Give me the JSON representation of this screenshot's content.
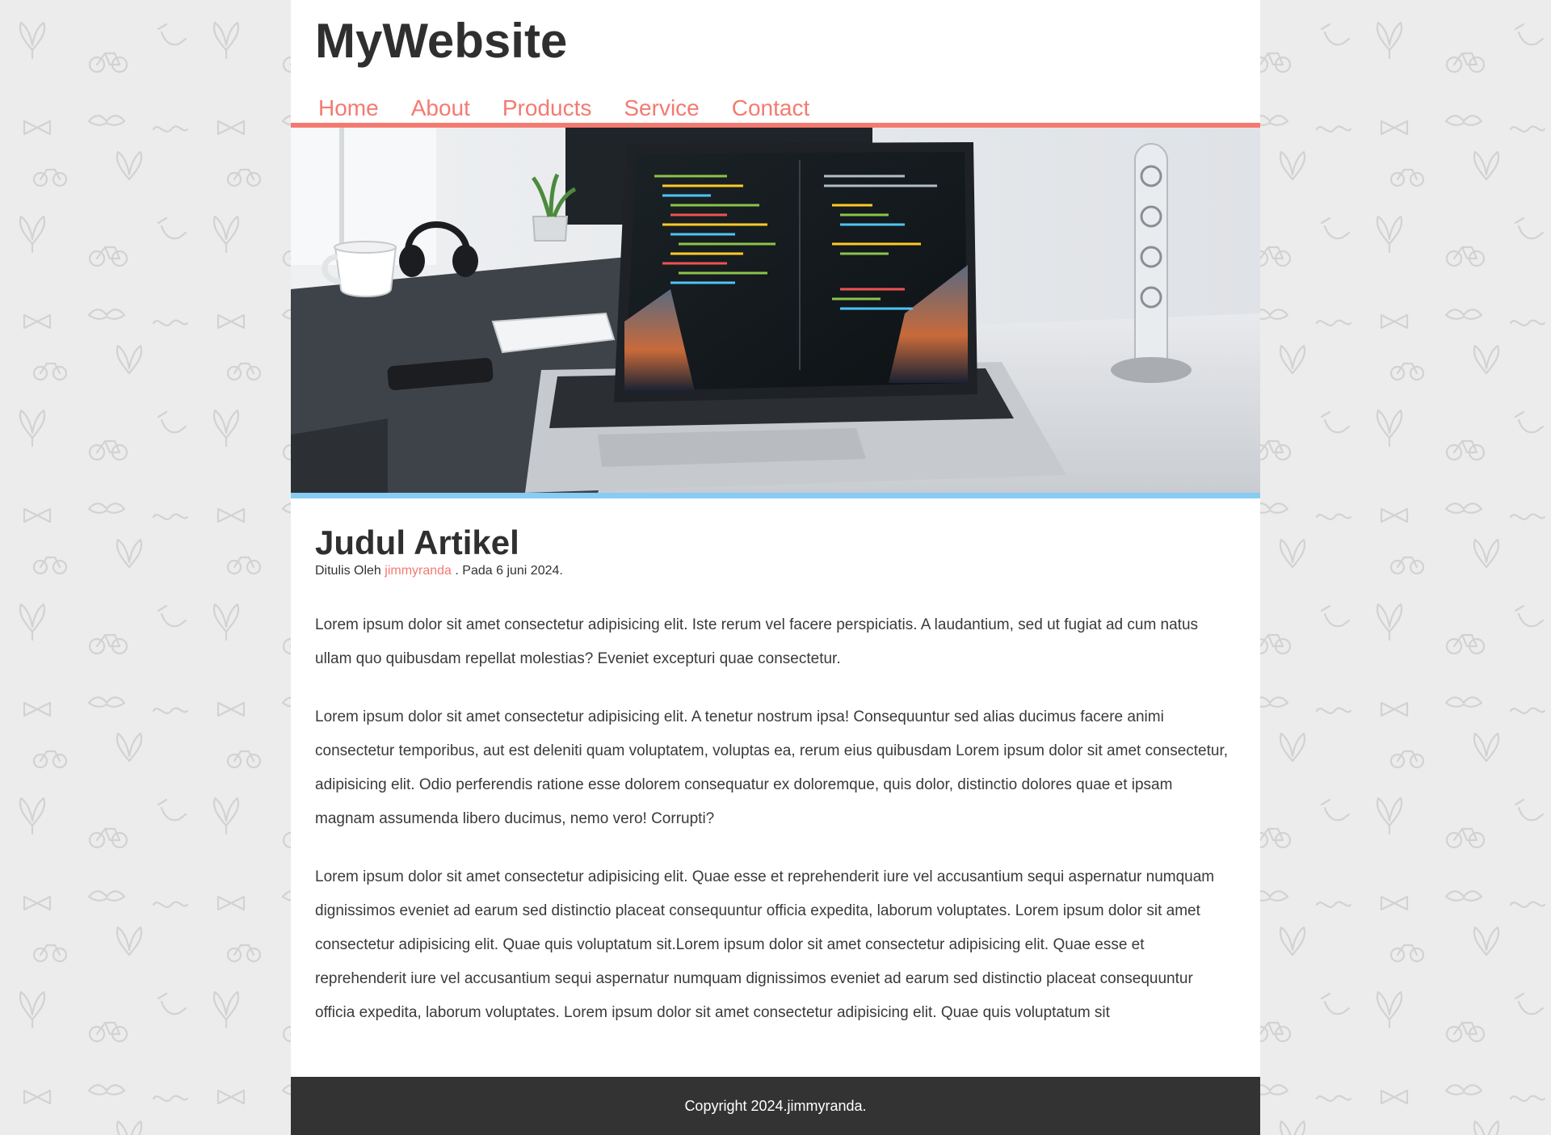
{
  "site": {
    "title": "MyWebsite"
  },
  "nav": {
    "items": [
      {
        "label": "Home"
      },
      {
        "label": "About"
      },
      {
        "label": "Products"
      },
      {
        "label": "Service"
      },
      {
        "label": "Contact"
      }
    ]
  },
  "hero": {
    "icon": "laptop-photo"
  },
  "article": {
    "title": "Judul Artikel",
    "meta_prefix": "Ditulis Oleh",
    "author": "jimmyranda",
    "meta_suffix": ". Pada 6 juni 2024.",
    "paragraphs": [
      "Lorem ipsum dolor sit amet consectetur adipisicing elit. Iste rerum vel facere perspiciatis. A laudantium, sed ut fugiat ad cum natus ullam quo quibusdam repellat molestias? Eveniet excepturi quae consectetur.",
      "Lorem ipsum dolor sit amet consectetur adipisicing elit. A tenetur nostrum ipsa! Consequuntur sed alias ducimus facere animi consectetur temporibus, aut est deleniti quam voluptatem, voluptas ea, rerum eius quibusdam Lorem ipsum dolor sit amet consectetur, adipisicing elit. Odio perferendis ratione esse dolorem consequatur ex doloremque, quis dolor, distinctio dolores quae et ipsam magnam assumenda libero ducimus, nemo vero! Corrupti?",
      "Lorem ipsum dolor sit amet consectetur adipisicing elit. Quae esse et reprehenderit iure vel accusantium sequi aspernatur numquam dignissimos eveniet ad earum sed distinctio placeat consequuntur officia expedita, laborum voluptates. Lorem ipsum dolor sit amet consectetur adipisicing elit. Quae quis voluptatum sit.Lorem ipsum dolor sit amet consectetur adipisicing elit. Quae esse et reprehenderit iure vel accusantium sequi aspernatur numquam dignissimos eveniet ad earum sed distinctio placeat consequuntur officia expedita, laborum voluptates. Lorem ipsum dolor sit amet consectetur adipisicing elit. Quae quis voluptatum sit"
    ]
  },
  "footer": {
    "copyright": "Copyright 2024.jimmyranda."
  },
  "colors": {
    "accent": "#f47a71",
    "hero_border": "#86ccf4",
    "footer_bg": "#333333",
    "page_bg": "#ececec",
    "text": "#2f2f2f"
  }
}
